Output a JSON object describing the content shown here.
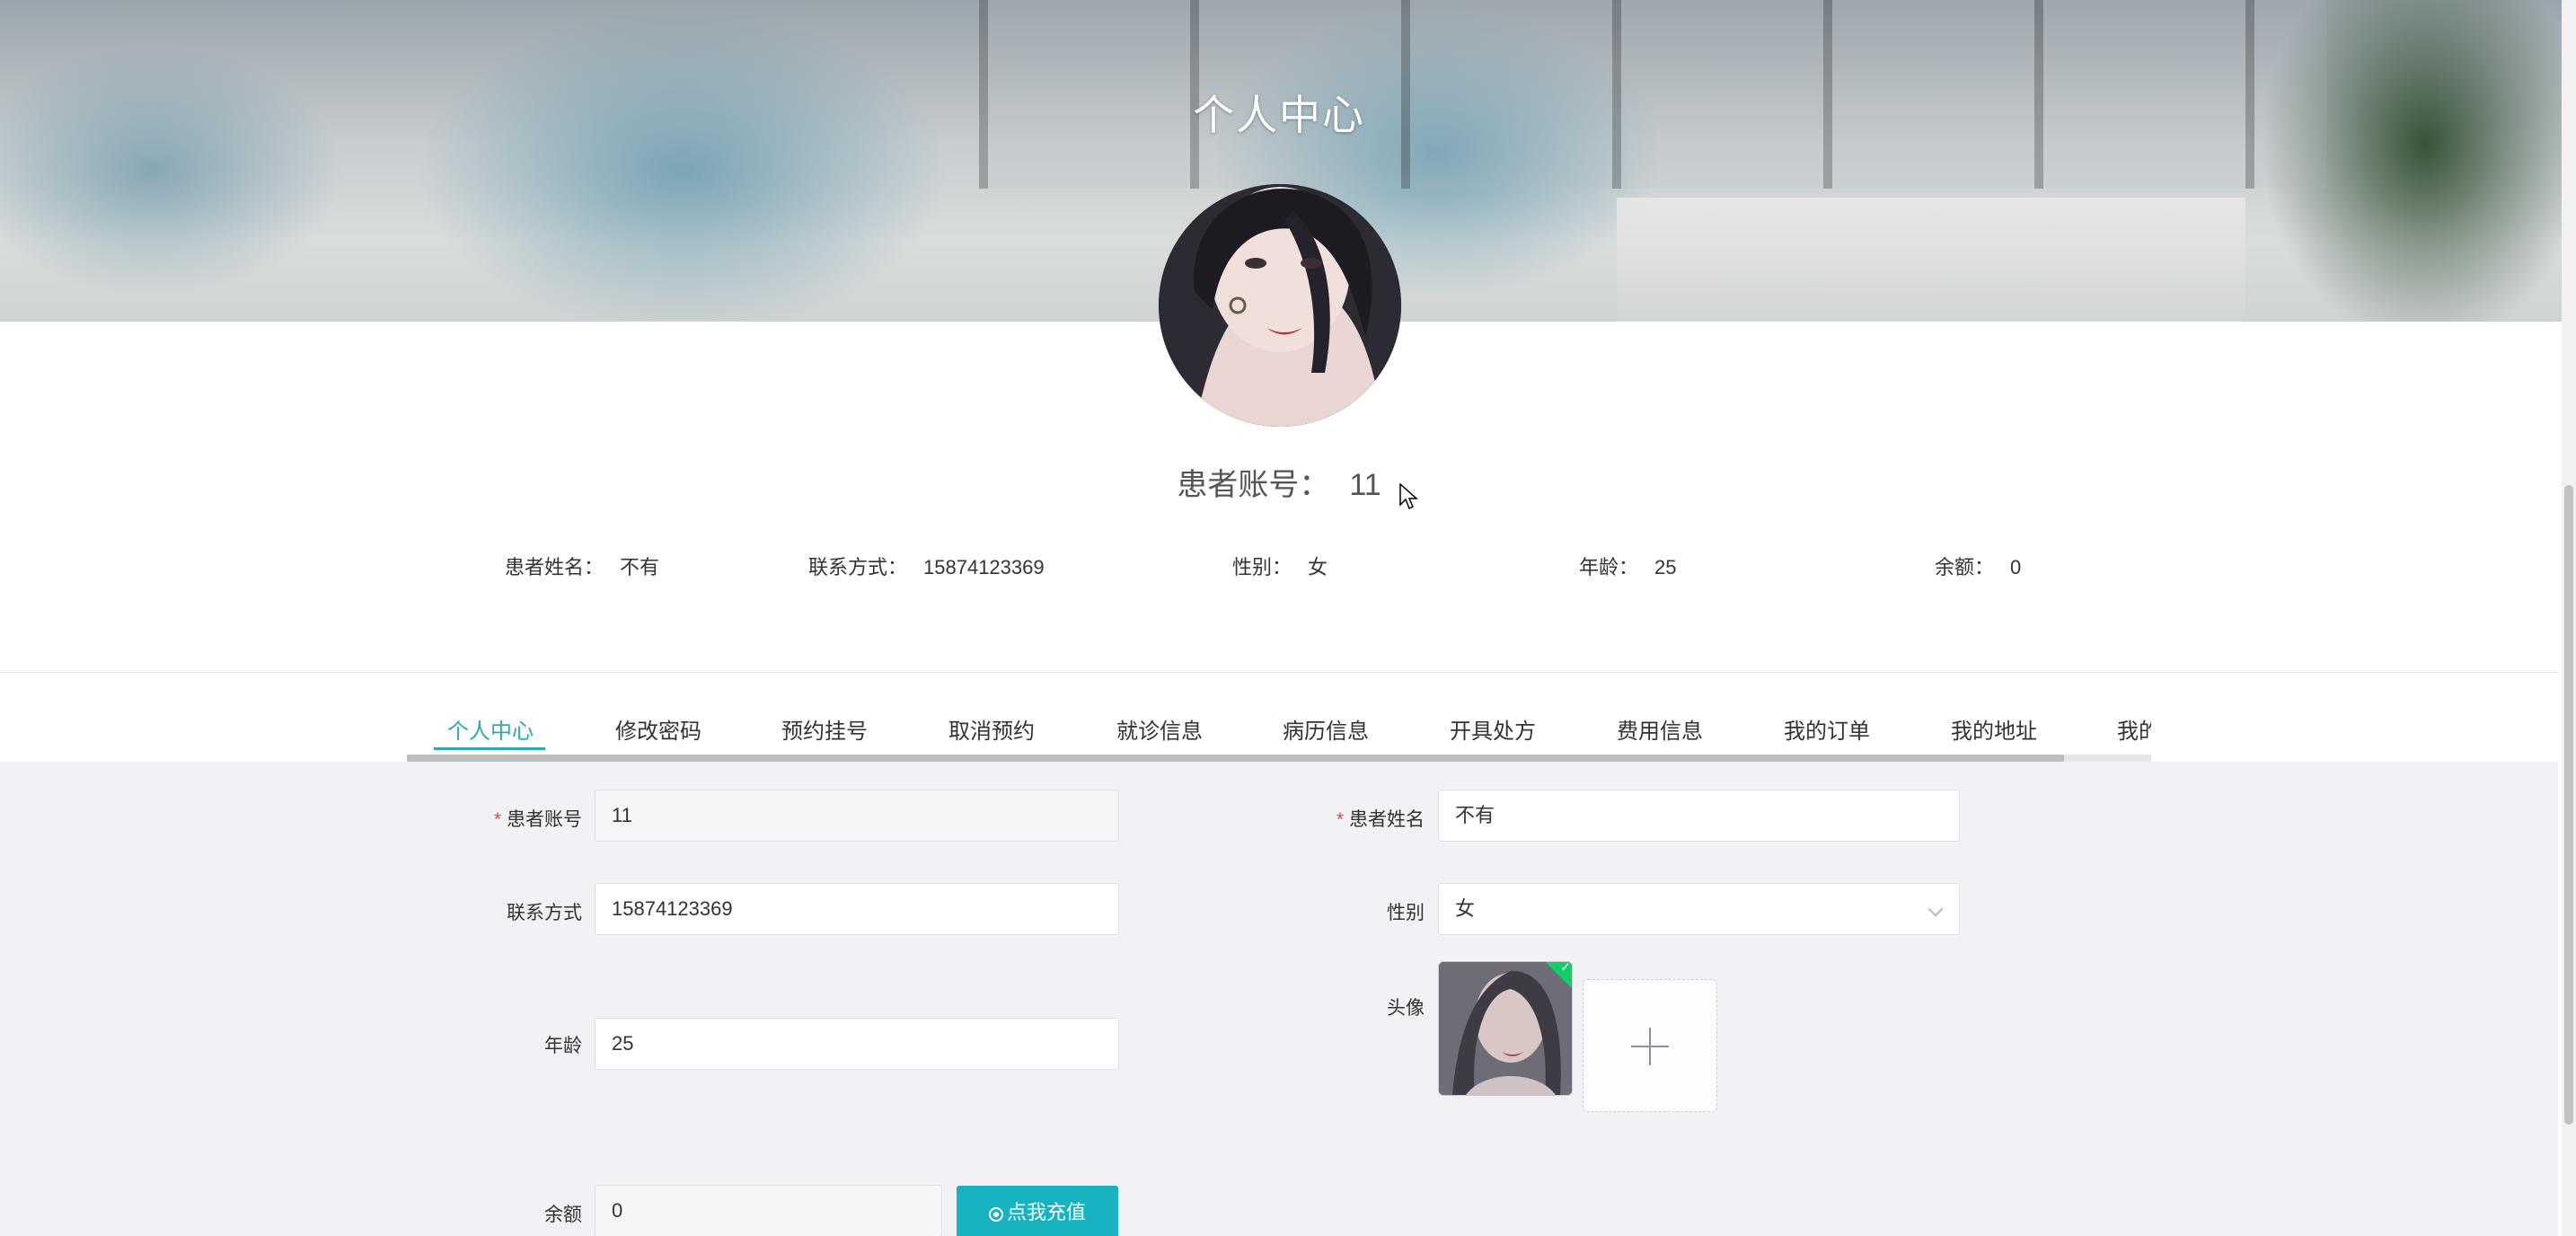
{
  "banner": {
    "title": "个人中心"
  },
  "profile": {
    "account_label": "患者账号：",
    "account_value": "11",
    "info": [
      {
        "label": "患者姓名：",
        "value": "不有"
      },
      {
        "label": "联系方式：",
        "value": "15874123369"
      },
      {
        "label": "性别：",
        "value": "女"
      },
      {
        "label": "年龄：",
        "value": "25"
      },
      {
        "label": "余额：",
        "value": "0"
      }
    ]
  },
  "tabs": [
    {
      "label": "个人中心",
      "active": true
    },
    {
      "label": "修改密码"
    },
    {
      "label": "预约挂号"
    },
    {
      "label": "取消预约"
    },
    {
      "label": "就诊信息"
    },
    {
      "label": "病历信息"
    },
    {
      "label": "开具处方"
    },
    {
      "label": "费用信息"
    },
    {
      "label": "我的订单"
    },
    {
      "label": "我的地址"
    },
    {
      "label": "我的"
    }
  ],
  "form": {
    "account": {
      "label": "患者账号",
      "value": "11",
      "required": true
    },
    "name": {
      "label": "患者姓名",
      "value": "不有",
      "required": true
    },
    "phone": {
      "label": "联系方式",
      "value": "15874123369"
    },
    "gender": {
      "label": "性别",
      "value": "女"
    },
    "age": {
      "label": "年龄",
      "value": "25"
    },
    "avatar": {
      "label": "头像"
    },
    "balance": {
      "label": "余额",
      "value": "0"
    },
    "recharge_button": "点我充值"
  },
  "colors": {
    "accent": "#2eaaaf",
    "button": "#17b3c0",
    "success": "#13ce66",
    "required": "#e0473f",
    "form_bg": "#f2f1f6"
  }
}
